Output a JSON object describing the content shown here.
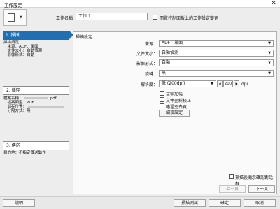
{
  "window": {
    "title": "工作設定"
  },
  "header": {
    "job_name_label": "工作名稱",
    "job_name_value": "工作 1",
    "panel_select_label": "閱覽控制面板上的工作設定變更"
  },
  "steps": [
    {
      "label": "1. 掃描",
      "lines": [
        "掃描設定",
        "　來源：ADF：單面",
        "　文件大小：自動偵測",
        "　影像形式：自動"
      ]
    },
    {
      "label": "2. 儲存",
      "lines": [
        "檔案名稱：",
        "　檔案類型：PDF",
        "　儲存位置：",
        "　分隔方式：無"
      ],
      "file_suffix": ".pdf"
    },
    {
      "label": "3. 傳送",
      "lines": [
        "目的地：不指定傳送動作"
      ]
    }
  ],
  "scan_settings": {
    "heading": "掃描設定",
    "fields": [
      {
        "label": "來源：",
        "value": "ADF：單面"
      },
      {
        "label": "文件大小：",
        "value": "自動偵測"
      },
      {
        "label": "影像形式：",
        "value": "自動"
      },
      {
        "label": "旋轉：",
        "value": "無"
      }
    ],
    "resolution": {
      "label": "解析度：",
      "value": "低 (200dpi)",
      "number": "200",
      "unit": "dpi"
    },
    "checkboxes": [
      "文字加強",
      "文件歪斜校正",
      "略過空白頁"
    ],
    "details_button": "細項設定",
    "confirm_checkbox": "掃描後顯示確認對話框"
  },
  "nav": {
    "prev": "上一頁",
    "next": "下一頁"
  },
  "footer": {
    "help": "說明",
    "test": "掃描測試",
    "ok": "確定",
    "cancel": "取消"
  }
}
